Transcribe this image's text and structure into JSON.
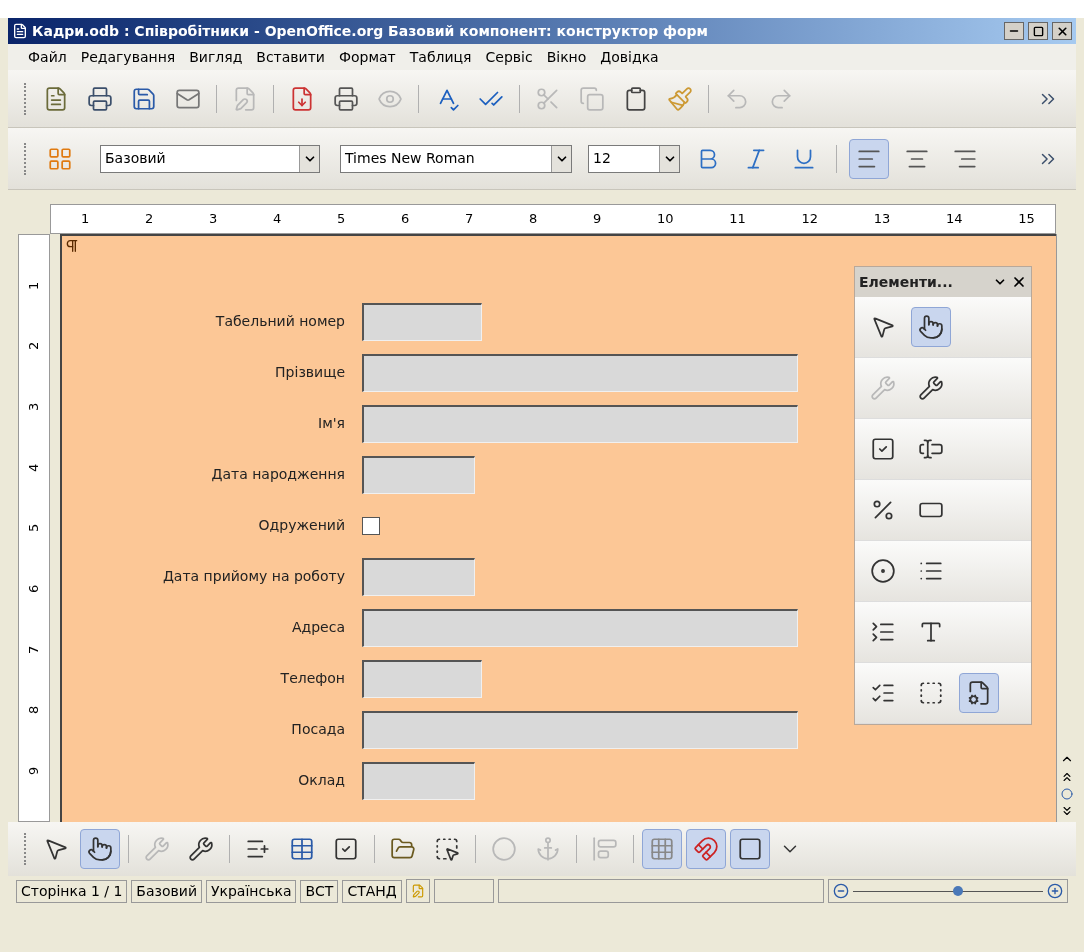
{
  "window": {
    "title": "Кадри.odb : Співробітники - OpenOffice.org Базовий компонент: конструктор форм"
  },
  "menu": [
    "Файл",
    "Редагування",
    "Вигляд",
    "Вставити",
    "Формат",
    "Таблиця",
    "Сервіс",
    "Вікно",
    "Довідка"
  ],
  "formatting_toolbar": {
    "style": "Базовий",
    "font": "Times New Roman",
    "size": "12",
    "alignment": [
      {
        "selected": true
      },
      {
        "selected": false
      },
      {
        "selected": false
      }
    ]
  },
  "ruler": {
    "horizontal": [
      "1",
      "2",
      "3",
      "4",
      "5",
      "6",
      "7",
      "8",
      "9",
      "10",
      "11",
      "12",
      "13",
      "14",
      "15"
    ],
    "vertical": [
      "1",
      "2",
      "3",
      "4",
      "5",
      "6",
      "7",
      "8",
      "9"
    ]
  },
  "form": {
    "fields": [
      {
        "label": "Табельний номер",
        "kind": "short"
      },
      {
        "label": "Прізвище",
        "kind": "long"
      },
      {
        "label": "Ім'я",
        "kind": "long"
      },
      {
        "label": "Дата народження",
        "kind": "medium"
      },
      {
        "label": "Одружений",
        "kind": "checkbox",
        "checked": false
      },
      {
        "label": "Дата прийому на роботу",
        "kind": "medium"
      },
      {
        "label": "Адреса",
        "kind": "long"
      },
      {
        "label": "Телефон",
        "kind": "short"
      },
      {
        "label": "Посада",
        "kind": "long"
      },
      {
        "label": "Оклад",
        "kind": "medium"
      }
    ]
  },
  "controls_panel": {
    "title": "Елементи...",
    "design_mode_on": true,
    "form_navigator_on": true
  },
  "form_design_toolbar": {
    "design_mode_on": true,
    "grid_on": true,
    "snap_on": true,
    "guides_on": true
  },
  "status_bar": {
    "page": "Сторінка 1 / 1",
    "style": "Базовий",
    "language": "Українська",
    "insert_mode": "ВСТ",
    "selection_mode": "СТАНД",
    "zoom": {
      "level": 0.55
    }
  }
}
